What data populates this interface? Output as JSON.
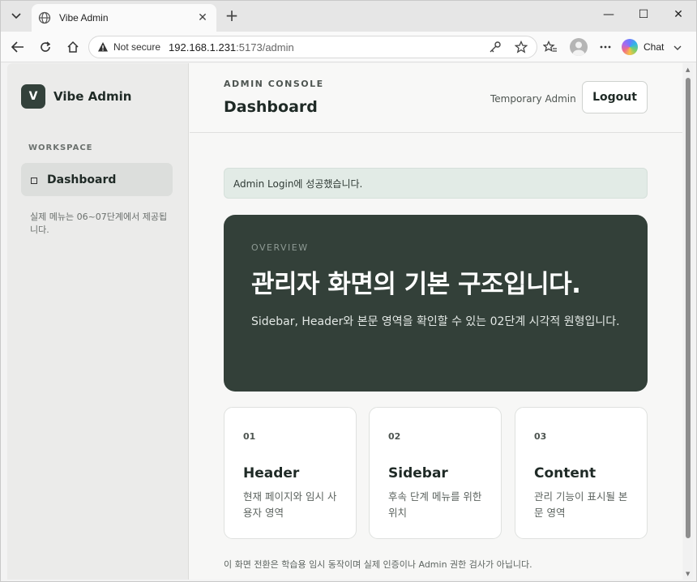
{
  "browser": {
    "tab_title": "Vibe Admin",
    "not_secure_label": "Not secure",
    "url_host": "192.168.1.231",
    "url_rest": ":5173/admin",
    "chat_label": "Chat"
  },
  "sidebar": {
    "brand_initial": "V",
    "brand_name": "Vibe Admin",
    "section_label": "WORKSPACE",
    "active_item": "Dashboard",
    "note": "실제 메뉴는 06~07단계에서 제공됩니다."
  },
  "header": {
    "eyebrow": "ADMIN CONSOLE",
    "title": "Dashboard",
    "user": "Temporary Admin",
    "logout_label": "Logout"
  },
  "alert": {
    "text": "Admin Login에 성공했습니다."
  },
  "hero": {
    "eyebrow": "OVERVIEW",
    "heading": "관리자 화면의 기본 구조입니다.",
    "description": "Sidebar, Header와 본문 영역을 확인할 수 있는 02단계 시각적 원형입니다."
  },
  "cards": [
    {
      "num": "01",
      "title": "Header",
      "text": "현재 페이지와 임시 사용자 영역"
    },
    {
      "num": "02",
      "title": "Sidebar",
      "text": "후속 단계 메뉴를 위한 위치"
    },
    {
      "num": "03",
      "title": "Content",
      "text": "관리 기능이 표시될 본문 영역"
    }
  ],
  "footnote": "이 화면 전환은 학습용 임시 동작이며 실제 인증이나 Admin 권한 검사가 아닙니다.",
  "icons": {
    "tab_menu": "chevron-down-icon",
    "tab_favicon": "globe-icon",
    "back": "arrow-left-icon",
    "reload": "reload-icon",
    "home": "home-icon",
    "security": "warning-icon",
    "password": "key-icon",
    "bookmark": "star-icon",
    "favorites": "favorites-icon",
    "profile": "avatar-icon",
    "more": "more-icon",
    "nav_item": "square-icon"
  },
  "colors": {
    "brand_dark": "#334039",
    "alert_bg": "#e2ebe6",
    "sidebar_bg": "#ebebea"
  }
}
